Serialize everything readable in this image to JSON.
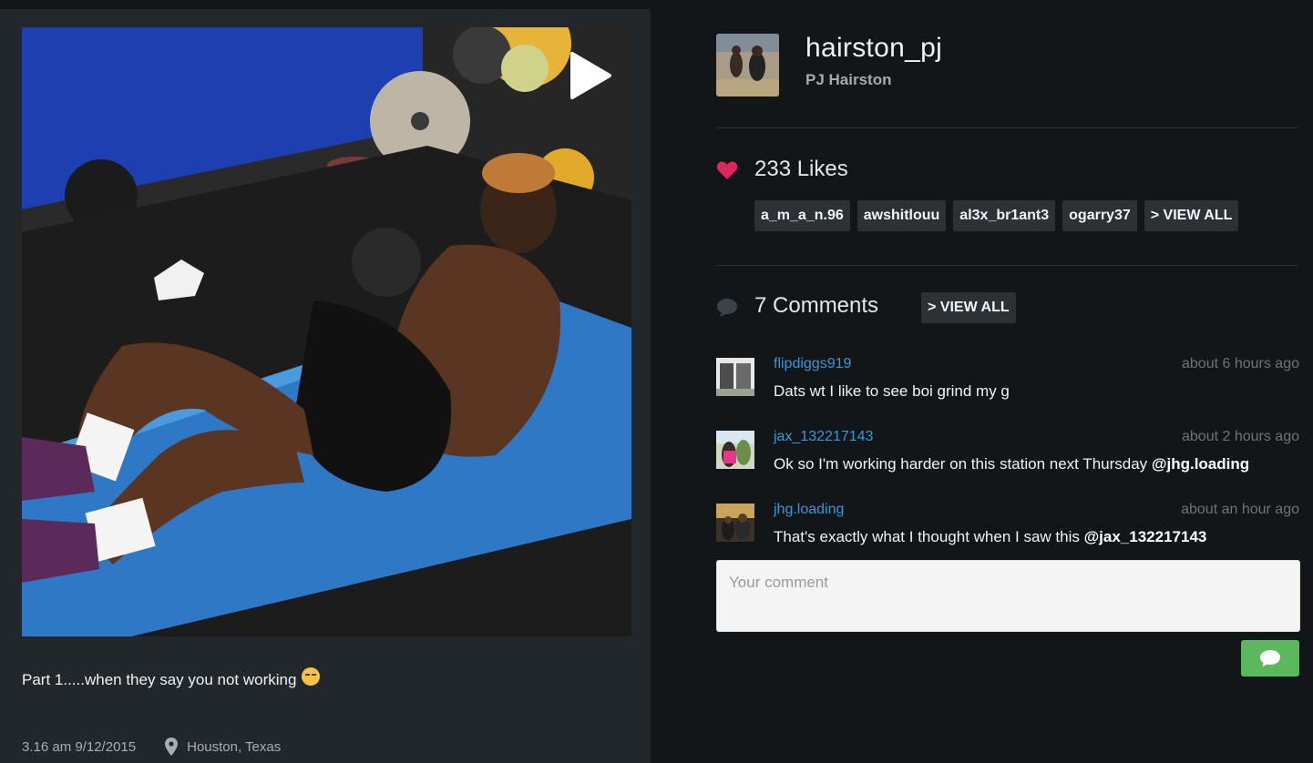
{
  "post": {
    "caption": "Part 1.....when they say you not working",
    "emoji_icon": "smirk-emoji-icon",
    "time": "3.16 am 9/12/2015",
    "location": "Houston, Texas",
    "play_icon": "play-icon",
    "location_icon": "map-pin-icon"
  },
  "profile": {
    "username": "hairston_pj",
    "full_name": "PJ Hairston"
  },
  "likes": {
    "icon": "heart-icon",
    "label": "233 Likes",
    "users": [
      "a_m_a_n.96",
      "awshitlouu",
      "al3x_br1ant3",
      "ogarry37"
    ],
    "view_all": "> VIEW ALL"
  },
  "comments": {
    "icon": "speech-bubble-icon",
    "label": "7 Comments",
    "view_all": "> VIEW ALL",
    "items": [
      {
        "user": "flipdiggs919",
        "time": "about 6 hours ago",
        "text": "Dats wt I like to see boi grind my g",
        "mention": ""
      },
      {
        "user": "jax_132217143",
        "time": "about 2 hours ago",
        "text": "Ok so I'm working harder on this station next Thursday ",
        "mention": "@jhg.loading"
      },
      {
        "user": "jhg.loading",
        "time": "about an hour ago",
        "text": "That's exactly what I thought when I saw this ",
        "mention": "@jax_132217143"
      }
    ],
    "input_placeholder": "Your comment",
    "send_icon": "chat-bubble-send-icon"
  },
  "colors": {
    "background": "#131619",
    "panel": "#22272c",
    "accent_link": "#3b96d4",
    "heart": "#e0245e",
    "send_button": "#5cb85c"
  }
}
